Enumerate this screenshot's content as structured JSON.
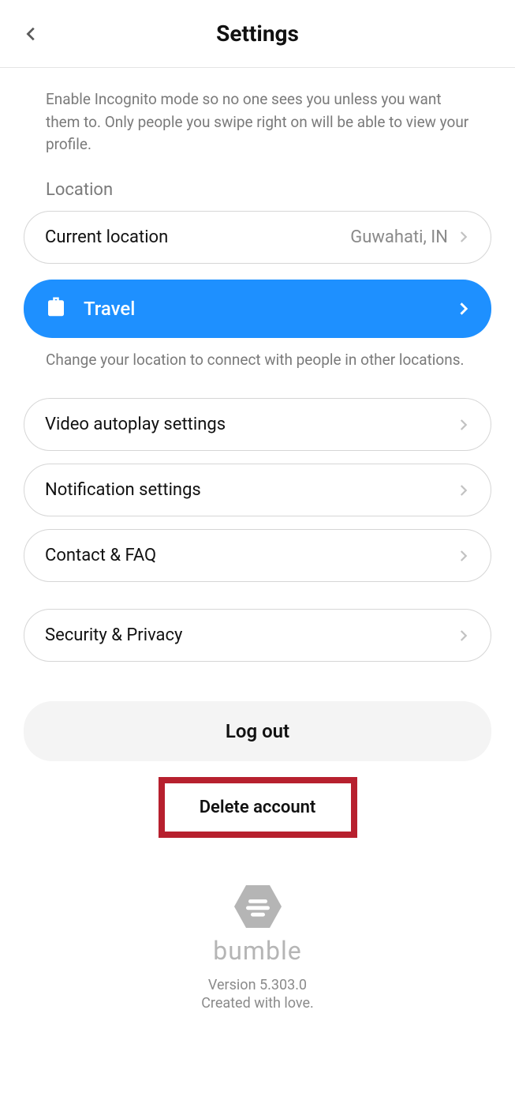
{
  "header": {
    "title": "Settings"
  },
  "incognito": {
    "description": "Enable Incognito mode so no one sees you unless you want them to. Only people you swipe right on will be able to view your profile."
  },
  "location": {
    "section_label": "Location",
    "current_label": "Current location",
    "current_value": "Guwahati, IN",
    "travel_label": "Travel",
    "travel_description": "Change your location to connect with people in other locations."
  },
  "rows": {
    "video": "Video autoplay settings",
    "notifications": "Notification settings",
    "contact": "Contact & FAQ",
    "security": "Security & Privacy"
  },
  "actions": {
    "logout": "Log out",
    "delete": "Delete account"
  },
  "footer": {
    "brand": "bumble",
    "version": "Version 5.303.0",
    "tagline": "Created with love."
  }
}
